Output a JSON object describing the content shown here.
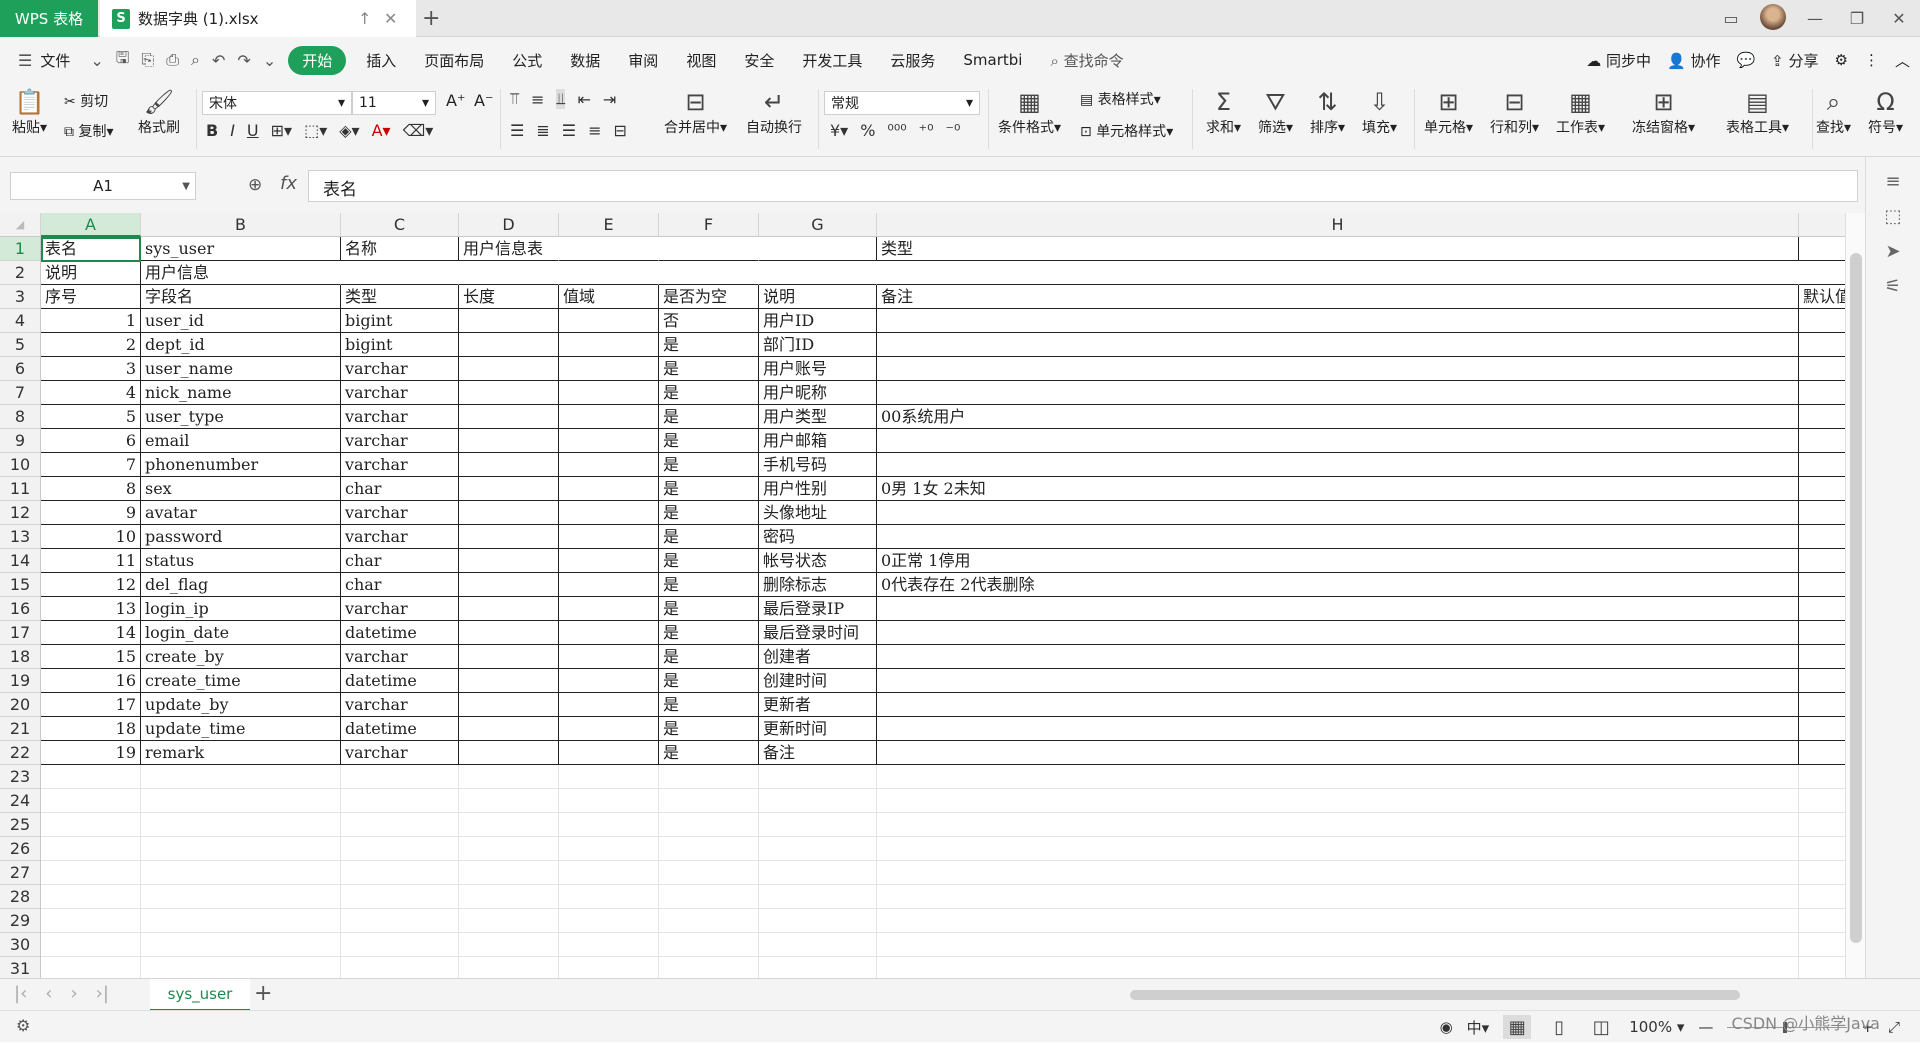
{
  "titlebar": {
    "app_tab": "WPS 表格",
    "doc_tab": "数据字典 (1).xlsx",
    "new_tab": "+"
  },
  "menu": {
    "file": "文件",
    "items": [
      "开始",
      "插入",
      "页面布局",
      "公式",
      "数据",
      "审阅",
      "视图",
      "安全",
      "开发工具",
      "云服务",
      "Smartbi"
    ],
    "search_cmd": "查找命令",
    "sync": "同步中",
    "collab": "协作",
    "share": "分享"
  },
  "ribbon": {
    "paste": "粘贴",
    "cut": "剪切",
    "copy": "复制",
    "format_painter": "格式刷",
    "font_name": "宋体",
    "font_size": "11",
    "number_format": "常规",
    "merge_center": "合并居中",
    "wrap": "自动换行",
    "cond_format": "条件格式",
    "table_style": "表格样式",
    "cell_style": "单元格样式",
    "sum": "求和",
    "filter": "筛选",
    "sort": "排序",
    "fill": "填充",
    "cell": "单元格",
    "rowcol": "行和列",
    "worksheet": "工作表",
    "freeze": "冻结窗格",
    "table_tools": "表格工具",
    "find": "查找",
    "symbol": "符号"
  },
  "formula_bar": {
    "name_box": "A1",
    "fx": "fx",
    "content": "表名"
  },
  "columns": [
    "A",
    "B",
    "C",
    "D",
    "E",
    "F",
    "G",
    "H"
  ],
  "rows": [
    [
      "表名",
      "sys_user",
      "名称",
      "用户信息表",
      "",
      "",
      "",
      "类型",
      ""
    ],
    [
      "说明",
      "用户信息",
      "",
      "",
      "",
      "",
      "",
      "",
      ""
    ],
    [
      "序号",
      "字段名",
      "类型",
      "长度",
      "值域",
      "是否为空",
      "说明",
      "备注",
      "默认值"
    ],
    [
      "1",
      "user_id",
      "bigint",
      "",
      "",
      "否",
      "用户ID",
      "",
      ""
    ],
    [
      "2",
      "dept_id",
      "bigint",
      "",
      "",
      "是",
      "部门ID",
      "",
      ""
    ],
    [
      "3",
      "user_name",
      "varchar",
      "",
      "",
      "是",
      "用户账号",
      "",
      ""
    ],
    [
      "4",
      "nick_name",
      "varchar",
      "",
      "",
      "是",
      "用户昵称",
      "",
      ""
    ],
    [
      "5",
      "user_type",
      "varchar",
      "",
      "",
      "是",
      "用户类型",
      "00系统用户",
      ""
    ],
    [
      "6",
      "email",
      "varchar",
      "",
      "",
      "是",
      "用户邮箱",
      "",
      ""
    ],
    [
      "7",
      "phonenumber",
      "varchar",
      "",
      "",
      "是",
      "手机号码",
      "",
      ""
    ],
    [
      "8",
      "sex",
      "char",
      "",
      "",
      "是",
      "用户性别",
      "0男 1女 2未知",
      ""
    ],
    [
      "9",
      "avatar",
      "varchar",
      "",
      "",
      "是",
      "头像地址",
      "",
      ""
    ],
    [
      "10",
      "password",
      "varchar",
      "",
      "",
      "是",
      "密码",
      "",
      ""
    ],
    [
      "11",
      "status",
      "char",
      "",
      "",
      "是",
      "帐号状态",
      "0正常 1停用",
      ""
    ],
    [
      "12",
      "del_flag",
      "char",
      "",
      "",
      "是",
      "删除标志",
      "0代表存在 2代表删除",
      ""
    ],
    [
      "13",
      "login_ip",
      "varchar",
      "",
      "",
      "是",
      "最后登录IP",
      "",
      ""
    ],
    [
      "14",
      "login_date",
      "datetime",
      "",
      "",
      "是",
      "最后登录时间",
      "",
      ""
    ],
    [
      "15",
      "create_by",
      "varchar",
      "",
      "",
      "是",
      "创建者",
      "",
      ""
    ],
    [
      "16",
      "create_time",
      "datetime",
      "",
      "",
      "是",
      "创建时间",
      "",
      ""
    ],
    [
      "17",
      "update_by",
      "varchar",
      "",
      "",
      "是",
      "更新者",
      "",
      ""
    ],
    [
      "18",
      "update_time",
      "datetime",
      "",
      "",
      "是",
      "更新时间",
      "",
      ""
    ],
    [
      "19",
      "remark",
      "varchar",
      "",
      "",
      "是",
      "备注",
      "",
      ""
    ]
  ],
  "total_rows": 31,
  "sheet_tab": "sys_user",
  "status": {
    "zoom": "100%",
    "watermark": "CSDN @小熊学Java"
  }
}
